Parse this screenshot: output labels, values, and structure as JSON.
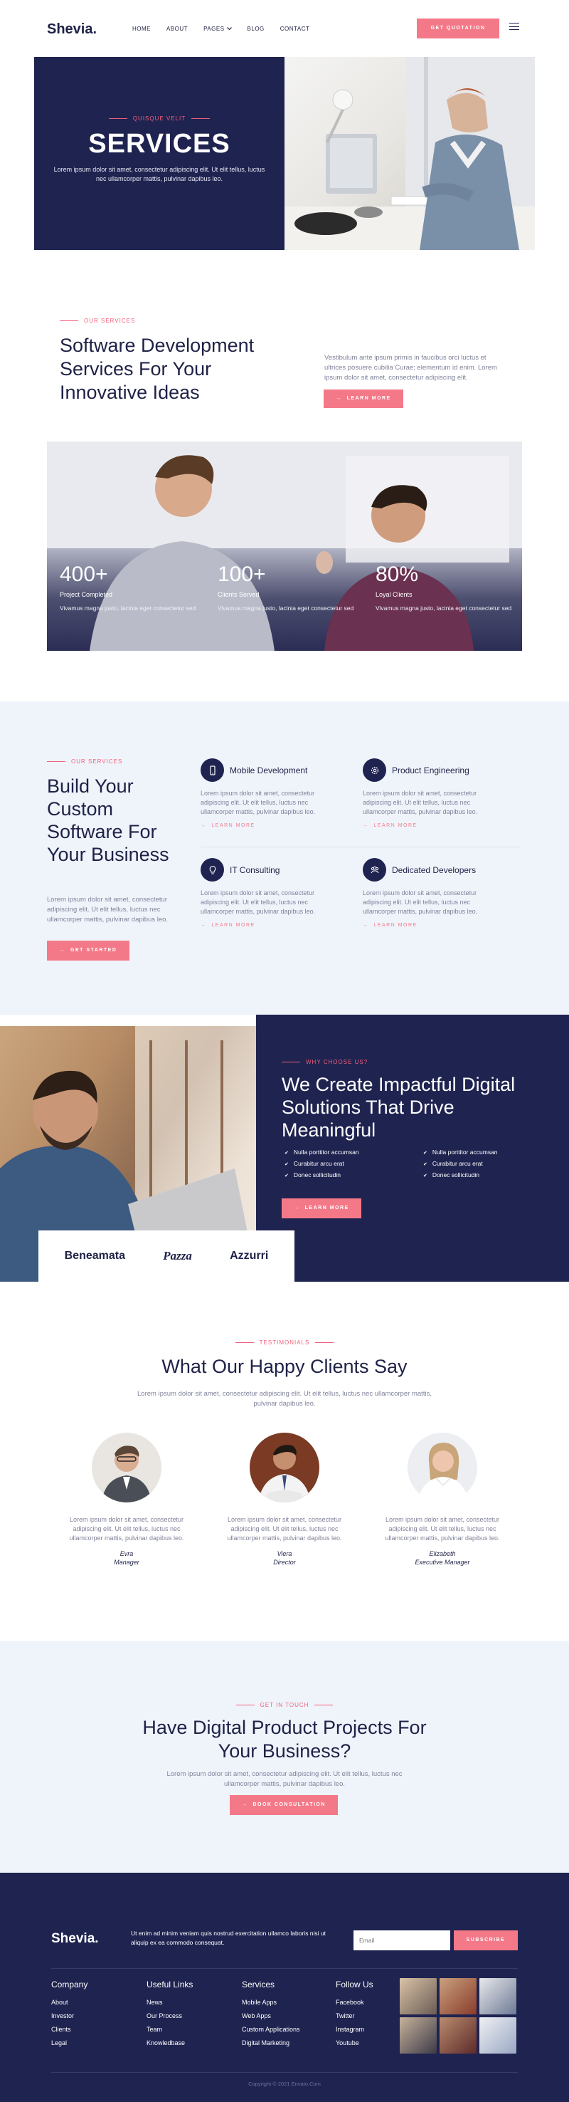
{
  "header": {
    "logo": "Shevia.",
    "nav": [
      {
        "label": "HOME"
      },
      {
        "label": "ABOUT"
      },
      {
        "label": "PAGES",
        "has_dropdown": true
      },
      {
        "label": "BLOG"
      },
      {
        "label": "CONTACT"
      }
    ],
    "cta_label": "GET QUOTATION"
  },
  "hero": {
    "eyebrow": "QUISQUE VELIT",
    "title": "SERVICES",
    "subtitle": "Lorem ipsum dolor sit amet, consectetur adipiscing elit. Ut elit tellus, luctus nec ullamcorper mattis, pulvinar dapibus leo."
  },
  "intro": {
    "eyebrow": "OUR SERVICES",
    "title": "Software Development Services For Your Innovative Ideas",
    "text": "Vestibulum ante ipsum primis in faucibus orci luctus et ultrices posuere cubilia Curae; elementum id enim. Lorem ipsum dolor sit amet, consectetur adipiscing elit.",
    "button_label": "LEARN MORE",
    "stats": [
      {
        "value": "400+",
        "label": "Project Completed",
        "desc": "Vivamus magna justo, lacinia eget consectetur sed"
      },
      {
        "value": "100+",
        "label": "Clients Served",
        "desc": "Vivamus magna justo, lacinia eget consectetur sed"
      },
      {
        "value": "80%",
        "label": "Loyal Clients",
        "desc": "Vivamus magna justo, lacinia eget consectetur sed"
      }
    ]
  },
  "services": {
    "eyebrow": "OUR SERVICES",
    "title": "Build Your Custom Software For Your Business",
    "text": "Lorem ipsum dolor sit amet, consectetur adipiscing elit. Ut elit tellus, luctus nec ullamcorper mattis, pulvinar dapibus leo.",
    "button_label": "GET STARTED",
    "items": [
      {
        "name": "Mobile Development",
        "icon": "mobile-icon",
        "desc": "Lorem ipsum dolor sit amet, consectetur adipiscing elit. Ut elit tellus, luctus nec ullamcorper mattis, pulvinar dapibus leo.",
        "more": "LEARN MORE"
      },
      {
        "name": "Product Engineering",
        "icon": "gear-icon",
        "desc": "Lorem ipsum dolor sit amet, consectetur adipiscing elit. Ut elit tellus, luctus nec ullamcorper mattis, pulvinar dapibus leo.",
        "more": "LEARN MORE"
      },
      {
        "name": "IT Consulting",
        "icon": "lightbulb-icon",
        "desc": "Lorem ipsum dolor sit amet, consectetur adipiscing elit. Ut elit tellus, luctus nec ullamcorper mattis, pulvinar dapibus leo.",
        "more": "LEARN MORE"
      },
      {
        "name": "Dedicated Developers",
        "icon": "team-icon",
        "desc": "Lorem ipsum dolor sit amet, consectetur adipiscing elit. Ut elit tellus, luctus nec ullamcorper mattis, pulvinar dapibus leo.",
        "more": "LEARN MORE"
      }
    ]
  },
  "why": {
    "eyebrow": "WHY CHOOSE US?",
    "title": "We Create Impactful Digital Solutions That Drive Meaningful",
    "checks": [
      "Nulla porttitor accumsan",
      "Nulla porttitor accumsan",
      "Curabitur arcu erat",
      "Curabitur arcu erat",
      "Donec sollicitudin",
      "Donec sollicitudin"
    ],
    "button_label": "LEARN MORE",
    "clients": [
      "Beneamata",
      "Pazza",
      "Azzurri"
    ]
  },
  "testimonials": {
    "eyebrow": "TESTIMONIALS",
    "title": "What Our Happy Clients Say",
    "subtitle": "Lorem ipsum dolor sit amet, consectetur adipiscing elit. Ut elit tellus, luctus nec ullamcorper mattis, pulvinar dapibus leo.",
    "items": [
      {
        "quote": "Lorem ipsum dolor sit amet, consectetur adipiscing elit. Ut elit tellus, luctus nec ullamcorper mattis, pulvinar dapibus leo.",
        "name": "Evra",
        "role": "Manager"
      },
      {
        "quote": "Lorem ipsum dolor sit amet, consectetur adipiscing elit. Ut elit tellus, luctus nec ullamcorper mattis, pulvinar dapibus leo.",
        "name": "Viera",
        "role": "Director"
      },
      {
        "quote": "Lorem ipsum dolor sit amet, consectetur adipiscing elit. Ut elit tellus, luctus nec ullamcorper mattis, pulvinar dapibus leo.",
        "name": "Elizabeth",
        "role": "Executive Manager"
      }
    ]
  },
  "contact": {
    "eyebrow": "GET IN TOUCH",
    "title": "Have Digital Product Projects For Your Business?",
    "subtitle": "Lorem ipsum dolor sit amet, consectetur adipiscing elit. Ut elit tellus, luctus nec ullamcorper mattis, pulvinar dapibus leo.",
    "button_label": "BOOK CONSULTATION"
  },
  "footer": {
    "logo": "Shevia.",
    "text": "Ut enim ad minim veniam quis nostrud exercitation ullamco laboris nisi ut aliquip ex ea commodo consequat.",
    "email_placeholder": "Email",
    "subscribe_label": "SUBSCRIBE",
    "columns": [
      {
        "title": "Company",
        "items": [
          "About",
          "Investor",
          "Clients",
          "Legal"
        ]
      },
      {
        "title": "Useful Links",
        "items": [
          "News",
          "Our Process",
          "Team",
          "Knowledbase"
        ]
      },
      {
        "title": "Services",
        "items": [
          "Mobile Apps",
          "Web Apps",
          "Custom Applications",
          "Digital Marketing"
        ]
      },
      {
        "title": "Follow Us",
        "items": [
          "Facebook",
          "Twitter",
          "Instagram",
          "Youtube"
        ]
      }
    ],
    "copyright": "Copyright © 2021 Envato.Com"
  },
  "colors": {
    "navy": "#1f2350",
    "accent": "#f47988",
    "light_bg": "#eff4fb"
  }
}
